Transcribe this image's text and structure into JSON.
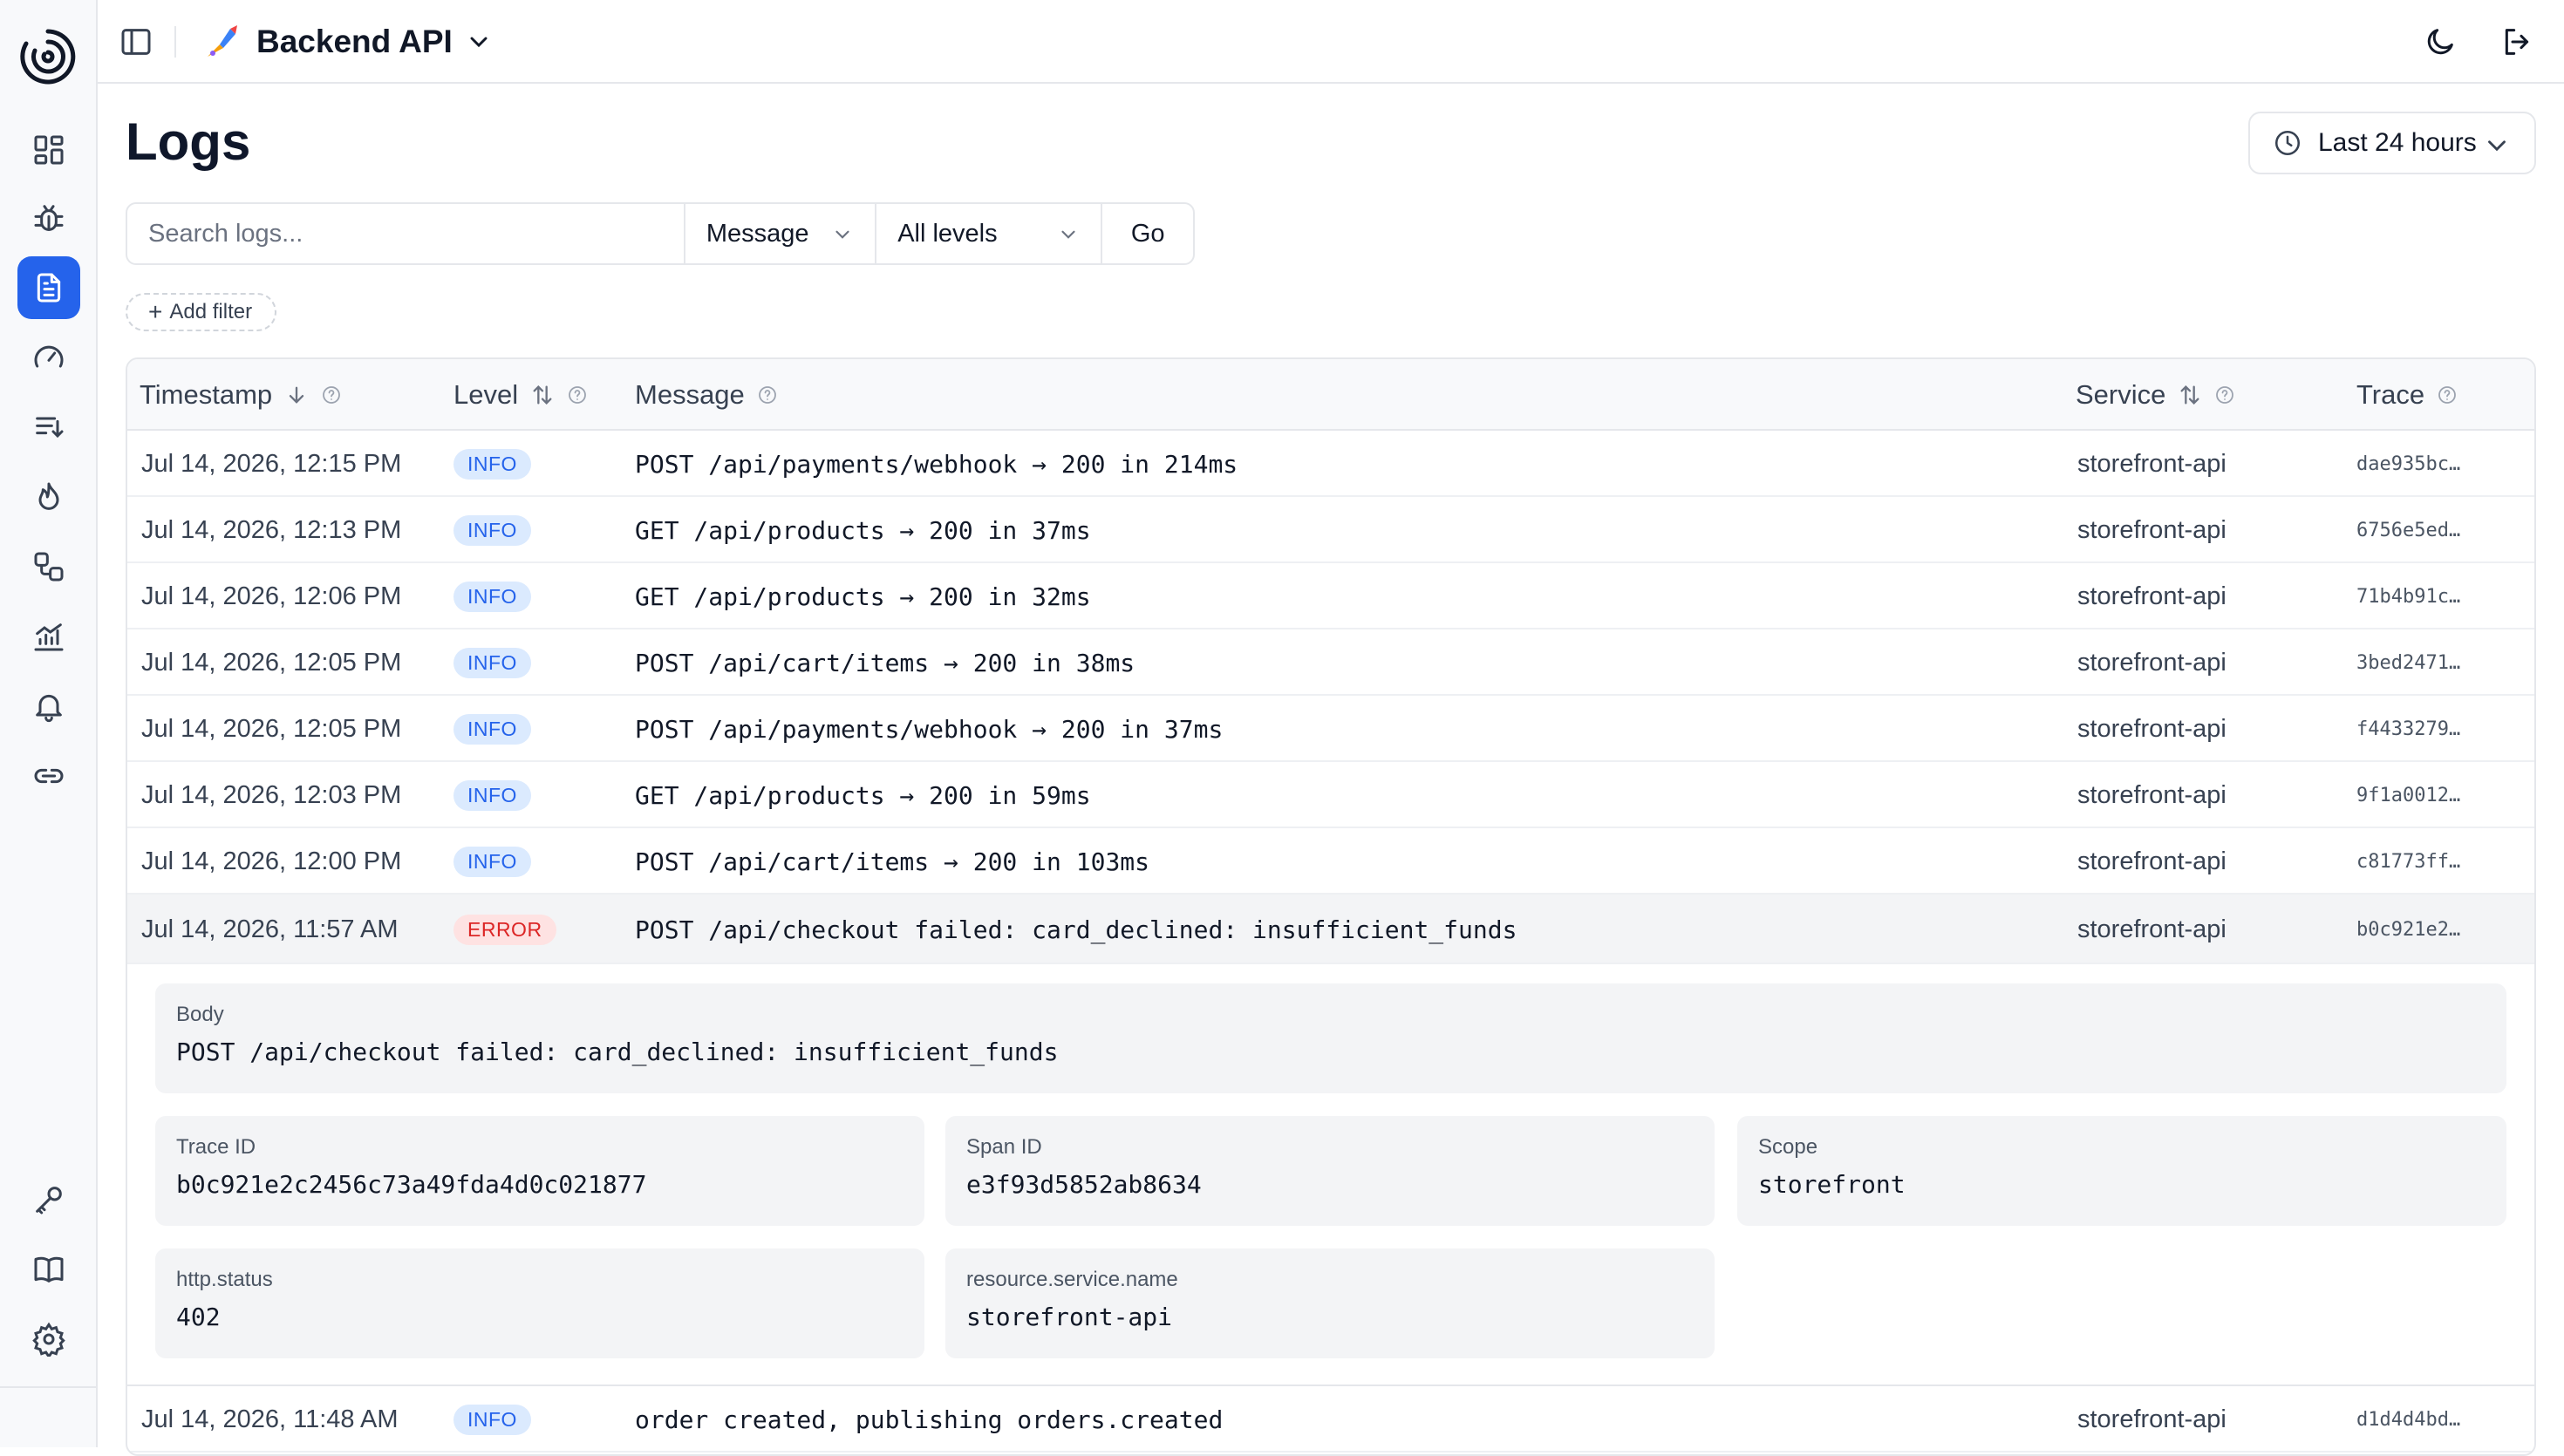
{
  "project": {
    "name": "Backend API"
  },
  "page": {
    "title": "Logs"
  },
  "time_range": {
    "label": "Last 24 hours"
  },
  "search": {
    "placeholder": "Search logs...",
    "field": "Message",
    "level": "All levels",
    "go_label": "Go"
  },
  "add_filter_label": "Add filter",
  "columns": {
    "timestamp": "Timestamp",
    "level": "Level",
    "message": "Message",
    "service": "Service",
    "trace": "Trace"
  },
  "rows": [
    {
      "ts": "Jul 14, 2026, 12:15 PM",
      "level": "INFO",
      "message": "POST /api/payments/webhook → 200 in 214ms",
      "service": "storefront-api",
      "trace": "dae935bc…"
    },
    {
      "ts": "Jul 14, 2026, 12:13 PM",
      "level": "INFO",
      "message": "GET /api/products → 200 in 37ms",
      "service": "storefront-api",
      "trace": "6756e5ed…"
    },
    {
      "ts": "Jul 14, 2026, 12:06 PM",
      "level": "INFO",
      "message": "GET /api/products → 200 in 32ms",
      "service": "storefront-api",
      "trace": "71b4b91c…"
    },
    {
      "ts": "Jul 14, 2026, 12:05 PM",
      "level": "INFO",
      "message": "POST /api/cart/items → 200 in 38ms",
      "service": "storefront-api",
      "trace": "3bed2471…"
    },
    {
      "ts": "Jul 14, 2026, 12:05 PM",
      "level": "INFO",
      "message": "POST /api/payments/webhook → 200 in 37ms",
      "service": "storefront-api",
      "trace": "f4433279…"
    },
    {
      "ts": "Jul 14, 2026, 12:03 PM",
      "level": "INFO",
      "message": "GET /api/products → 200 in 59ms",
      "service": "storefront-api",
      "trace": "9f1a0012…"
    },
    {
      "ts": "Jul 14, 2026, 12:00 PM",
      "level": "INFO",
      "message": "POST /api/cart/items → 200 in 103ms",
      "service": "storefront-api",
      "trace": "c81773ff…"
    },
    {
      "ts": "Jul 14, 2026, 11:57 AM",
      "level": "ERROR",
      "message": "POST /api/checkout failed: card_declined: insufficient_funds",
      "service": "storefront-api",
      "trace": "b0c921e2…"
    },
    {
      "ts": "Jul 14, 2026, 11:48 AM",
      "level": "INFO",
      "message": "order created, publishing orders.created",
      "service": "storefront-api",
      "trace": "d1d4d4bd…"
    }
  ],
  "detail": {
    "body_label": "Body",
    "body": "POST /api/checkout failed: card_declined: insufficient_funds",
    "trace_id_label": "Trace ID",
    "trace_id": "b0c921e2c2456c73a49fda4d0c021877",
    "span_id_label": "Span ID",
    "span_id": "e3f93d5852ab8634",
    "scope_label": "Scope",
    "scope": "storefront",
    "http_status_label": "http.status",
    "http_status": "402",
    "service_name_label": "resource.service.name",
    "service_name": "storefront-api"
  },
  "colors": {
    "accent": "#2563eb",
    "info_bg": "#dbeafe",
    "info_fg": "#2563eb",
    "error_bg": "#fee2e2",
    "error_fg": "#dc2626"
  },
  "icons": {
    "sidebar": [
      "dashboard-icon",
      "bug-icon",
      "logs-icon",
      "gauge-icon",
      "trace-list-icon",
      "flame-icon",
      "services-icon",
      "chart-icon",
      "bell-icon",
      "link-icon",
      "key-icon",
      "book-icon",
      "gear-icon"
    ]
  }
}
